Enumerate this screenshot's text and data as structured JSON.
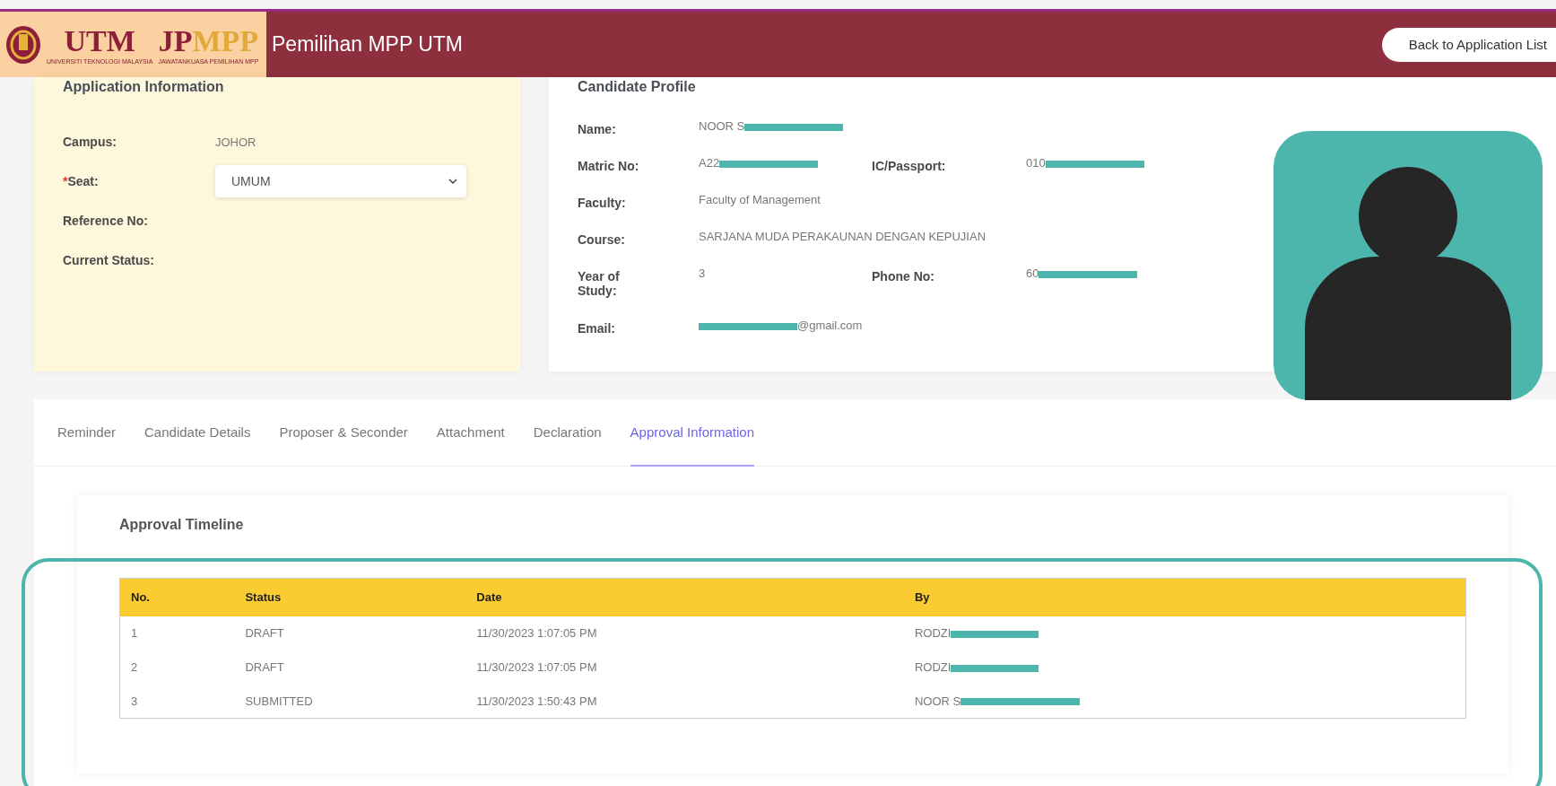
{
  "header": {
    "logo": {
      "emblem_text": "UTM",
      "emblem_caption": "UNIVERSITI TEKNOLOGI MALAYSIA",
      "mark_left": "JP",
      "mark_right": "MPP",
      "mark_caption": "JAWATANKUASA PEMILIHAN MPP"
    },
    "title": "Pemilihan MPP UTM",
    "back_button": "Back to Application List"
  },
  "application_info": {
    "title": "Application Information",
    "fields": [
      {
        "kind": "text",
        "label": "Campus:",
        "value": "JOHOR"
      },
      {
        "kind": "select",
        "label": "Seat:",
        "required_mark": "*",
        "value": "UMUM"
      },
      {
        "kind": "text",
        "label": "Reference No:"
      },
      {
        "kind": "text",
        "label": "Current Status:"
      }
    ]
  },
  "candidate_profile": {
    "title": "Candidate Profile",
    "rows": [
      [
        {
          "label": "Name:",
          "value": "NOOR S",
          "redacted": true
        }
      ],
      [
        {
          "label": "Matric No:",
          "value": "A22",
          "redacted": true
        },
        {
          "label": "IC/Passport:",
          "value": "010",
          "redacted": true
        }
      ],
      [
        {
          "label": "Faculty:",
          "value": "Faculty of Management"
        }
      ],
      [
        {
          "label": "Course:",
          "value": "SARJANA MUDA PERAKAUNAN DENGAN KEPUJIAN"
        }
      ],
      [
        {
          "label": "Year of Study:",
          "value": "3"
        },
        {
          "label": "Phone No:",
          "value": "60",
          "redacted": true
        }
      ],
      [
        {
          "label": "Email:",
          "value_tail": "@gmail.com",
          "redacted": true
        }
      ]
    ]
  },
  "tabs": [
    {
      "label": "Reminder",
      "selected": false
    },
    {
      "label": "Candidate Details",
      "selected": false
    },
    {
      "label": "Proposer & Seconder",
      "selected": false
    },
    {
      "label": "Attachment",
      "selected": false
    },
    {
      "label": "Declaration",
      "selected": false
    },
    {
      "label": "Approval Information",
      "selected": true
    }
  ],
  "approval_timeline": {
    "title": "Approval Timeline",
    "columns": [
      "No.",
      "Status",
      "Date",
      "By"
    ],
    "rows": [
      {
        "cells": [
          "1",
          "DRAFT",
          "11/30/2023 1:07:05 PM",
          "RODZI"
        ],
        "redacted": true
      },
      {
        "cells": [
          "2",
          "DRAFT",
          "11/30/2023 1:07:05 PM",
          "RODZI"
        ],
        "redacted": true
      },
      {
        "cells": [
          "3",
          "SUBMITTED",
          "11/30/2023 1:50:43 PM",
          "NOOR S"
        ],
        "redacted": true
      }
    ]
  }
}
